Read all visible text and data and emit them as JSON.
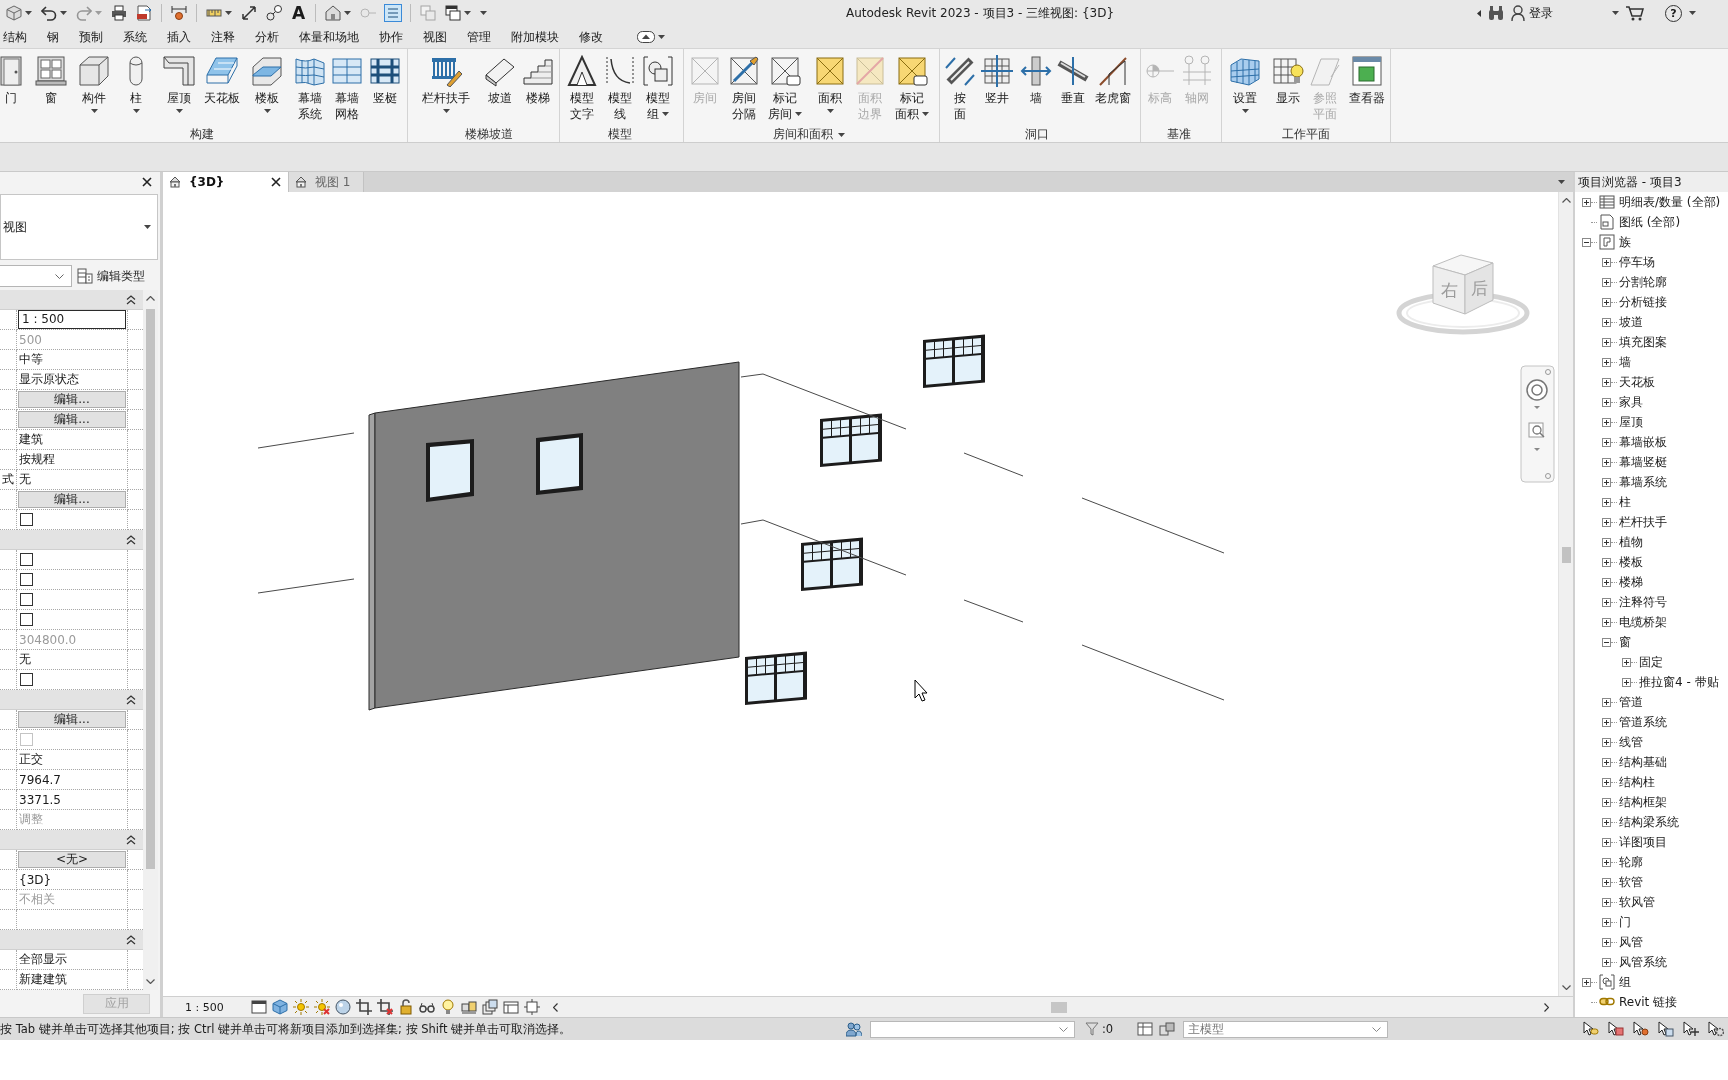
{
  "title_bar": {
    "quick_access": [
      {
        "kind": "icon",
        "dropdown": true,
        "disabled": false,
        "on": false
      },
      {
        "kind": "icon",
        "dropdown": true,
        "disabled": false,
        "on": false
      },
      {
        "kind": "icon",
        "dropdown": true,
        "disabled": true,
        "on": false
      },
      {
        "kind": "icon",
        "dropdown": false,
        "disabled": false,
        "on": false
      },
      {
        "kind": "icon",
        "dropdown": false,
        "disabled": false,
        "on": false
      },
      {
        "kind": "icon",
        "dropdown": false,
        "disabled": false,
        "on": false
      },
      {
        "kind": "icon",
        "dropdown": true,
        "disabled": false,
        "on": false
      },
      {
        "kind": "icon",
        "dropdown": false,
        "disabled": false,
        "on": false
      },
      {
        "kind": "icon",
        "dropdown": false,
        "disabled": false,
        "on": false
      },
      {
        "kind": "glyph",
        "glyph": "A",
        "dropdown": false,
        "disabled": false,
        "on": false
      },
      {
        "kind": "icon",
        "dropdown": true,
        "disabled": false,
        "on": false
      },
      {
        "kind": "icon",
        "dropdown": false,
        "disabled": true,
        "on": false
      },
      {
        "kind": "icon",
        "dropdown": false,
        "disabled": false,
        "on": true
      },
      {
        "kind": "icon",
        "dropdown": false,
        "disabled": true,
        "on": false
      },
      {
        "kind": "icon",
        "dropdown": true,
        "disabled": false,
        "on": false
      },
      {
        "kind": "menu",
        "dropdown": true,
        "disabled": false,
        "on": false
      }
    ],
    "title": "Autodesk Revit 2023 - 项目3 - 三维视图: {3D}",
    "sign_in": "登录",
    "help": "?"
  },
  "ribbon_tabs": [
    {
      "label": "结构",
      "selected": false
    },
    {
      "label": "钢",
      "selected": false
    },
    {
      "label": "预制",
      "selected": false
    },
    {
      "label": "系统",
      "selected": false
    },
    {
      "label": "插入",
      "selected": false
    },
    {
      "label": "注释",
      "selected": false
    },
    {
      "label": "分析",
      "selected": false
    },
    {
      "label": "体量和场地",
      "selected": false
    },
    {
      "label": "协作",
      "selected": false
    },
    {
      "label": "视图",
      "selected": false
    },
    {
      "label": "管理",
      "selected": false
    },
    {
      "label": "附加模块",
      "selected": false
    },
    {
      "label": "修改",
      "selected": false
    }
  ],
  "ribbon": {
    "panels": [
      {
        "label": "构建",
        "dropdown": false,
        "buttons": [
          {
            "lines": [
              "门"
            ],
            "dropdown": false,
            "disabled": false
          },
          {
            "lines": [
              "窗"
            ],
            "dropdown": false,
            "disabled": false
          },
          {
            "lines": [
              "构件"
            ],
            "dropdown": true,
            "disabled": false
          },
          {
            "lines": [
              "柱"
            ],
            "dropdown": true,
            "disabled": false
          },
          {
            "lines": [
              "屋顶"
            ],
            "dropdown": true,
            "disabled": false
          },
          {
            "lines": [
              "天花板"
            ],
            "dropdown": false,
            "disabled": false
          },
          {
            "lines": [
              "楼板"
            ],
            "dropdown": true,
            "disabled": false
          },
          {
            "lines": [
              "幕墙",
              "系统"
            ],
            "dropdown": false,
            "disabled": false
          },
          {
            "lines": [
              "幕墙",
              "网格"
            ],
            "dropdown": false,
            "disabled": false
          },
          {
            "lines": [
              "竖梃"
            ],
            "dropdown": false,
            "disabled": false
          }
        ]
      },
      {
        "label": "楼梯坡道",
        "dropdown": false,
        "buttons": [
          {
            "lines": [
              "栏杆扶手"
            ],
            "dropdown": true,
            "disabled": false
          },
          {
            "lines": [
              "坡道"
            ],
            "dropdown": false,
            "disabled": false
          },
          {
            "lines": [
              "楼梯"
            ],
            "dropdown": false,
            "disabled": false
          }
        ]
      },
      {
        "label": "模型",
        "dropdown": false,
        "buttons": [
          {
            "lines": [
              "模型",
              "文字"
            ],
            "dropdown": false,
            "disabled": false
          },
          {
            "lines": [
              "模型",
              "线"
            ],
            "dropdown": false,
            "disabled": false
          },
          {
            "lines": [
              "模型",
              "组"
            ],
            "dropdown": true,
            "disabled": false
          }
        ]
      },
      {
        "label": "房间和面积",
        "dropdown": true,
        "buttons": [
          {
            "lines": [
              "房间"
            ],
            "dropdown": false,
            "disabled": true
          },
          {
            "lines": [
              "房间",
              "分隔"
            ],
            "dropdown": false,
            "disabled": false
          },
          {
            "lines": [
              "标记",
              "房间"
            ],
            "dropdown": true,
            "disabled": false
          },
          {
            "lines": [
              "面积"
            ],
            "dropdown": true,
            "disabled": false
          },
          {
            "lines": [
              "面积",
              "边界"
            ],
            "dropdown": false,
            "disabled": true
          },
          {
            "lines": [
              "标记",
              "面积"
            ],
            "dropdown": true,
            "disabled": false
          }
        ]
      },
      {
        "label": "洞口",
        "dropdown": false,
        "buttons": [
          {
            "lines": [
              "按",
              "面"
            ],
            "dropdown": false,
            "disabled": false
          },
          {
            "lines": [
              "竖井"
            ],
            "dropdown": false,
            "disabled": false
          },
          {
            "lines": [
              "墙"
            ],
            "dropdown": false,
            "disabled": false
          },
          {
            "lines": [
              "垂直"
            ],
            "dropdown": false,
            "disabled": false
          },
          {
            "lines": [
              "老虎窗"
            ],
            "dropdown": false,
            "disabled": false
          }
        ]
      },
      {
        "label": "基准",
        "dropdown": false,
        "buttons": [
          {
            "lines": [
              "标高"
            ],
            "dropdown": false,
            "disabled": true
          },
          {
            "lines": [
              "轴网"
            ],
            "dropdown": false,
            "disabled": true
          }
        ]
      },
      {
        "label": "工作平面",
        "dropdown": false,
        "buttons": [
          {
            "lines": [
              "设置"
            ],
            "dropdown": true,
            "disabled": false
          },
          {
            "lines": [
              "显示"
            ],
            "dropdown": false,
            "disabled": false
          },
          {
            "lines": [
              "参照",
              "平面"
            ],
            "dropdown": false,
            "disabled": true
          },
          {
            "lines": [
              "查看器"
            ],
            "dropdown": false,
            "disabled": false
          }
        ]
      }
    ]
  },
  "properties": {
    "type_selector": "视图",
    "edit_type": "编辑类型",
    "sections": [
      {
        "expanded": true,
        "rows": [
          {
            "kind": "input",
            "value": "1 : 500"
          },
          {
            "kind": "text",
            "value": "500",
            "disabled": true
          },
          {
            "kind": "text",
            "value": "中等",
            "disabled": false
          },
          {
            "kind": "text",
            "value": "显示原状态",
            "disabled": false
          },
          {
            "kind": "button",
            "value": "编辑..."
          },
          {
            "kind": "button",
            "value": "编辑..."
          },
          {
            "kind": "text",
            "value": "建筑",
            "disabled": false
          },
          {
            "kind": "text",
            "value": "按规程",
            "disabled": false
          },
          {
            "kind": "text",
            "label": "式",
            "value": "无",
            "disabled": false
          },
          {
            "kind": "button",
            "value": "编辑..."
          },
          {
            "kind": "checkbox",
            "checked": false,
            "disabled": false
          }
        ]
      },
      {
        "expanded": true,
        "rows": [
          {
            "kind": "checkbox",
            "checked": false,
            "disabled": false
          },
          {
            "kind": "checkbox",
            "checked": false,
            "disabled": false
          },
          {
            "kind": "checkbox",
            "checked": false,
            "disabled": false
          },
          {
            "kind": "checkbox",
            "checked": false,
            "disabled": false
          },
          {
            "kind": "text",
            "value": "304800.0",
            "disabled": true
          },
          {
            "kind": "text",
            "value": "无",
            "disabled": false
          },
          {
            "kind": "checkbox",
            "checked": false,
            "disabled": false
          }
        ]
      },
      {
        "expanded": true,
        "rows": [
          {
            "kind": "button",
            "value": "编辑..."
          },
          {
            "kind": "checkbox",
            "checked": false,
            "disabled": true
          },
          {
            "kind": "text",
            "value": "正交",
            "disabled": false
          },
          {
            "kind": "text",
            "value": "7964.7",
            "disabled": false
          },
          {
            "kind": "text",
            "value": "3371.5",
            "disabled": false
          },
          {
            "kind": "text",
            "value": "调整",
            "disabled": true
          }
        ]
      },
      {
        "expanded": true,
        "rows": [
          {
            "kind": "button",
            "value": "<无>"
          },
          {
            "kind": "text",
            "value": "{3D}",
            "disabled": false
          },
          {
            "kind": "text",
            "value": "不相关",
            "disabled": true
          },
          {
            "kind": "blank"
          }
        ]
      },
      {
        "expanded": true,
        "rows": [
          {
            "kind": "text",
            "value": "全部显示",
            "disabled": false
          },
          {
            "kind": "text",
            "value": "新建建筑",
            "disabled": false
          }
        ]
      }
    ],
    "apply": {
      "label": "应用",
      "disabled": true
    }
  },
  "view_tabs": [
    {
      "label": "{3D}",
      "selected": true
    },
    {
      "label": "视图 1",
      "selected": false
    }
  ],
  "canvas": {
    "view_cube": {
      "faces": [
        "右",
        "后"
      ]
    }
  },
  "view_control_bar": {
    "scale": "1 : 500"
  },
  "project_browser": {
    "title": "项目浏览器 - 项目3",
    "tree": [
      {
        "label": "明细表/数量 (全部)",
        "expanded": false
      },
      {
        "label": "图纸 (全部)"
      },
      {
        "label": "族",
        "expanded": true,
        "children": [
          {
            "label": "停车场",
            "expanded": false
          },
          {
            "label": "分割轮廓",
            "expanded": false
          },
          {
            "label": "分析链接",
            "expanded": false
          },
          {
            "label": "坡道",
            "expanded": false
          },
          {
            "label": "填充图案",
            "expanded": false
          },
          {
            "label": "墙",
            "expanded": false
          },
          {
            "label": "天花板",
            "expanded": false
          },
          {
            "label": "家具",
            "expanded": false
          },
          {
            "label": "屋顶",
            "expanded": false
          },
          {
            "label": "幕墙嵌板",
            "expanded": false
          },
          {
            "label": "幕墙竖梃",
            "expanded": false
          },
          {
            "label": "幕墙系统",
            "expanded": false
          },
          {
            "label": "柱",
            "expanded": false
          },
          {
            "label": "栏杆扶手",
            "expanded": false
          },
          {
            "label": "植物",
            "expanded": false
          },
          {
            "label": "楼板",
            "expanded": false
          },
          {
            "label": "楼梯",
            "expanded": false
          },
          {
            "label": "注释符号",
            "expanded": false
          },
          {
            "label": "电缆桥架",
            "expanded": false
          },
          {
            "label": "窗",
            "expanded": true,
            "children": [
              {
                "label": "固定",
                "expanded": false
              },
              {
                "label": "推拉窗4 - 带贴",
                "expanded": false
              }
            ]
          },
          {
            "label": "管道",
            "expanded": false
          },
          {
            "label": "管道系统",
            "expanded": false
          },
          {
            "label": "线管",
            "expanded": false
          },
          {
            "label": "结构基础",
            "expanded": false
          },
          {
            "label": "结构柱",
            "expanded": false
          },
          {
            "label": "结构框架",
            "expanded": false
          },
          {
            "label": "结构梁系统",
            "expanded": false
          },
          {
            "label": "详图项目",
            "expanded": false
          },
          {
            "label": "轮廓",
            "expanded": false
          },
          {
            "label": "软管",
            "expanded": false
          },
          {
            "label": "软风管",
            "expanded": false
          },
          {
            "label": "门",
            "expanded": false
          },
          {
            "label": "风管",
            "expanded": false
          },
          {
            "label": "风管系统",
            "expanded": false
          }
        ]
      },
      {
        "label": "组",
        "expanded": false
      },
      {
        "label": "Revit 链接"
      }
    ]
  },
  "status_bar": {
    "hint": "按 Tab 键并单击可选择其他项目; 按 Ctrl 键并单击可将新项目添加到选择集; 按 Shift 键并单击可取消选择。",
    "selection_count": ":0",
    "active_model": "主模型"
  }
}
